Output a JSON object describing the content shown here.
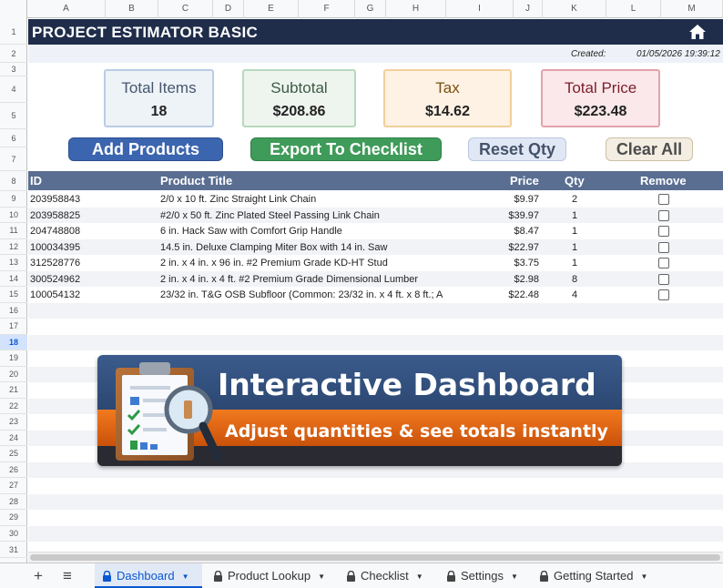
{
  "columns": [
    "A",
    "B",
    "C",
    "D",
    "E",
    "F",
    "G",
    "H",
    "I",
    "J",
    "K",
    "L",
    "M"
  ],
  "rows": [
    "1",
    "2",
    "3",
    "4",
    "5",
    "6",
    "7",
    "8",
    "9",
    "10",
    "11",
    "12",
    "13",
    "14",
    "15",
    "16",
    "17",
    "18",
    "19",
    "20",
    "21",
    "22",
    "23",
    "24",
    "25",
    "26",
    "27",
    "28",
    "29",
    "30",
    "31"
  ],
  "selected_row": "18",
  "title": "PROJECT ESTIMATOR BASIC",
  "created_label": "Created:",
  "created_value": "01/05/2026 19:39:12",
  "cards": [
    {
      "label": "Total Items",
      "value": "18",
      "bg": "#eef3f8",
      "border": "#b9cde3",
      "color": "#46566e"
    },
    {
      "label": "Subtotal",
      "value": "$208.86",
      "bg": "#eef5ef",
      "border": "#b6d9bd",
      "color": "#3f5a45"
    },
    {
      "label": "Tax",
      "value": "$14.62",
      "bg": "#fdf2e3",
      "border": "#f2cf9b",
      "color": "#7a4f12"
    },
    {
      "label": "Total Price",
      "value": "$223.48",
      "bg": "#fbe8ea",
      "border": "#e3a3ac",
      "color": "#7a1f2b"
    }
  ],
  "buttons": {
    "add": "Add Products",
    "export": "Export To Checklist",
    "reset": "Reset Qty",
    "clear": "Clear All"
  },
  "table": {
    "headers": {
      "id": "ID",
      "title": "Product Title",
      "price": "Price",
      "qty": "Qty",
      "remove": "Remove"
    },
    "rows": [
      {
        "id": "203958843",
        "title": "2/0 x 10 ft. Zinc Straight Link Chain",
        "price": "$9.97",
        "qty": "2"
      },
      {
        "id": "203958825",
        "title": "#2/0 x 50 ft. Zinc Plated Steel Passing Link Chain",
        "price": "$39.97",
        "qty": "1"
      },
      {
        "id": "204748808",
        "title": "6 in. Hack Saw with Comfort Grip Handle",
        "price": "$8.47",
        "qty": "1"
      },
      {
        "id": "100034395",
        "title": "14.5 in. Deluxe Clamping Miter Box with 14 in. Saw",
        "price": "$22.97",
        "qty": "1"
      },
      {
        "id": "312528776",
        "title": "2 in. x 4 in. x 96 in. #2 Premium Grade KD-HT Stud",
        "price": "$3.75",
        "qty": "1"
      },
      {
        "id": "300524962",
        "title": "2 in. x 4 in. x 4 ft. #2 Premium Grade Dimensional Lumber",
        "price": "$2.98",
        "qty": "8"
      },
      {
        "id": "100054132",
        "title": "23/32 in. T&G OSB Subfloor (Common: 23/32 in. x 4 ft. x 8 ft.; A",
        "price": "$22.48",
        "qty": "4"
      }
    ]
  },
  "banner": {
    "title": "Interactive Dashboard",
    "subtitle": "Adjust quantities & see totals instantly"
  },
  "tabs": [
    {
      "label": "Dashboard",
      "active": true
    },
    {
      "label": "Product Lookup",
      "active": false
    },
    {
      "label": "Checklist",
      "active": false
    },
    {
      "label": "Settings",
      "active": false
    },
    {
      "label": "Getting Started",
      "active": false
    }
  ],
  "icons": {
    "home": "home-icon",
    "add_sheet": "plus-icon",
    "all_sheets": "menu-icon",
    "lock": "lock-icon"
  }
}
